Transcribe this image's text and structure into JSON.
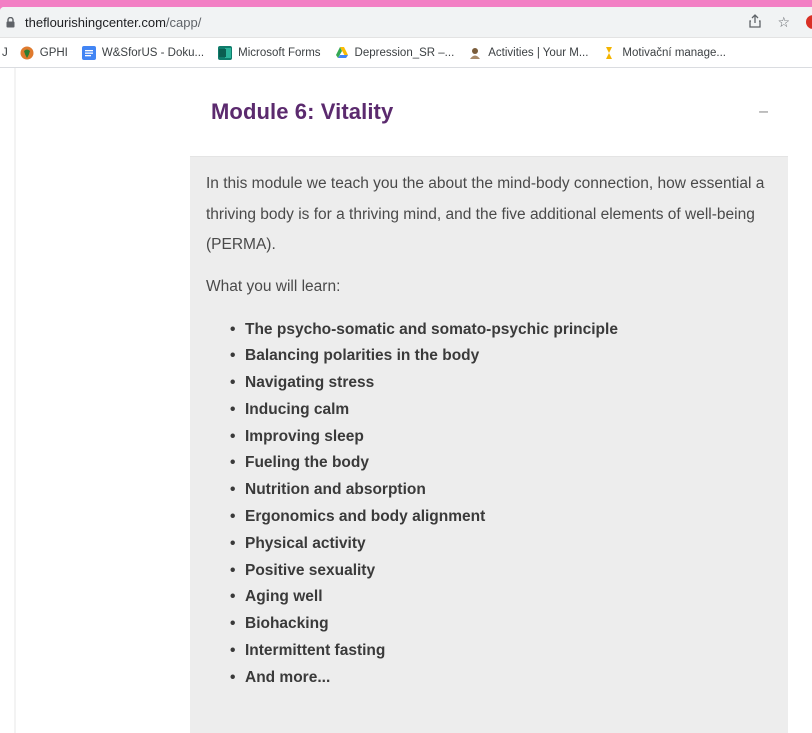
{
  "browser": {
    "url_domain": "theflourishingcenter.com",
    "url_path": "/capp/",
    "bookmarks": [
      {
        "label": "J",
        "color": "#3c4043"
      },
      {
        "label": "GPHI",
        "color": "#e07a2e"
      },
      {
        "label": "W&SforUS - Doku...",
        "color": "#4285f4"
      },
      {
        "label": "Microsoft Forms",
        "color": "#107c6b"
      },
      {
        "label": "Depression_SR –...",
        "color": "#34a853"
      },
      {
        "label": "Activities | Your M...",
        "color": "#7a5c3a"
      },
      {
        "label": "Motivační manage...",
        "color": "#f4b400"
      }
    ]
  },
  "module": {
    "title": "Module 6: Vitality",
    "collapse_symbol": "–",
    "intro": "In this module we teach you the about the mind-body connection, how essential a thriving body is for a thriving mind, and the five additional elements of well-being (PERMA).",
    "learn_heading": "What you will learn:",
    "topics": [
      "The psycho-somatic and somato-psychic principle",
      "Balancing polarities in the body",
      "Navigating stress",
      "Inducing calm",
      "Improving sleep",
      "Fueling the body",
      "Nutrition and absorption",
      "Ergonomics and body alignment",
      "Physical activity",
      "Positive sexuality",
      "Aging well",
      "Biohacking",
      "Intermittent fasting",
      "And more..."
    ]
  }
}
